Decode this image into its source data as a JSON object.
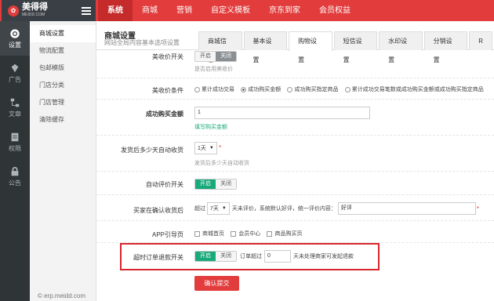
{
  "brand": {
    "name": "美得得",
    "sub": "MEIDD.COM"
  },
  "topnav": [
    "系统",
    "商城",
    "营销",
    "自定义模板",
    "京东到家",
    "会员权益"
  ],
  "iconbar": [
    "设置",
    "广告",
    "文章",
    "权限",
    "公告"
  ],
  "subnav": [
    "商城设置",
    "物流配置",
    "包邮模版",
    "门店分类",
    "门店管理",
    "清除缓存"
  ],
  "copyright": "© erp.meidd.com",
  "header": {
    "title": "商城设置",
    "subtitle": "网站全局内容基本选项设置"
  },
  "tabs": [
    "商城信息",
    "基本设置",
    "购物设置",
    "短信设置",
    "水印设置",
    "分销设置",
    "R"
  ],
  "form": {
    "review_switch": {
      "label": "美收价开关",
      "on": "开启",
      "off": "关闭",
      "help": "是否启用美收价"
    },
    "review_cond": {
      "label": "美收价条件",
      "options": [
        "累计成功交易",
        "成功购买金额",
        "成功购买指定商品",
        "累计成功交易笔数或成功购买金额或成功购买指定商品"
      ]
    },
    "amount": {
      "label": "成功购买金额",
      "value": "1",
      "help": "填写购买金额"
    },
    "auto_receive": {
      "label": "发货后多少天自动收货",
      "value": "1天",
      "help": "发货后多少天自动收货"
    },
    "auto_review": {
      "label": "自动评价开关",
      "on": "开启",
      "off": "关闭"
    },
    "confirm_receive": {
      "label": "买家在确认收货后",
      "prefix": "超过",
      "value": "7天",
      "mid": "天未评价，系统默认好评，统一评价内容：",
      "content": "好评"
    },
    "app_guide": {
      "label": "APP引导页",
      "options": [
        "商城首页",
        "会员中心",
        "商品购买页"
      ]
    },
    "timeout_refund": {
      "label": "超时订单退款开关",
      "on": "开启",
      "off": "关闭",
      "prefix": "订单超过",
      "value": "0",
      "suffix": "天未处理商家可发起退款"
    },
    "submit": "确认提交"
  }
}
